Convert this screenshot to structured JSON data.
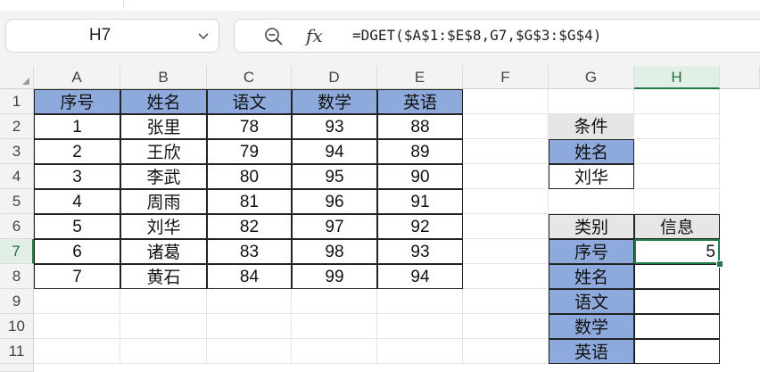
{
  "name_box": {
    "value": "H7"
  },
  "formula_bar": {
    "fx_label": "fx",
    "formula": "=DGET($A$1:$E$8,G7,$G$3:$G$4)"
  },
  "columns": [
    "A",
    "B",
    "C",
    "D",
    "E",
    "F",
    "G",
    "H"
  ],
  "rows": [
    "1",
    "2",
    "3",
    "4",
    "5",
    "6",
    "7",
    "8",
    "9",
    "10",
    "11"
  ],
  "active_cell": {
    "column": "H",
    "row": "7"
  },
  "cells": {
    "A1": "序号",
    "B1": "姓名",
    "C1": "语文",
    "D1": "数学",
    "E1": "英语",
    "A2": "1",
    "B2": "张里",
    "C2": "78",
    "D2": "93",
    "E2": "88",
    "A3": "2",
    "B3": "王欣",
    "C3": "79",
    "D3": "94",
    "E3": "89",
    "A4": "3",
    "B4": "李武",
    "C4": "80",
    "D4": "95",
    "E4": "90",
    "A5": "4",
    "B5": "周雨",
    "C5": "81",
    "D5": "96",
    "E5": "91",
    "A6": "5",
    "B6": "刘华",
    "C6": "82",
    "D6": "97",
    "E6": "92",
    "A7": "6",
    "B7": "诸葛",
    "C7": "83",
    "D7": "98",
    "E7": "93",
    "A8": "7",
    "B8": "黄石",
    "C8": "84",
    "D8": "99",
    "E8": "94",
    "G2": "条件",
    "G3": "姓名",
    "G4": "刘华",
    "G6": "类别",
    "H6": "信息",
    "G7": "序号",
    "H7": "5",
    "G8": "姓名",
    "G9": "语文",
    "G10": "数学",
    "G11": "英语"
  },
  "colors": {
    "header_fill": "#8ea9db",
    "gray_fill": "#e7e6e6",
    "accent_green": "#1f7a45"
  },
  "icons": {
    "name_box_dropdown": "chevron-down-icon",
    "formula_zoom": "zoom-out-icon"
  }
}
